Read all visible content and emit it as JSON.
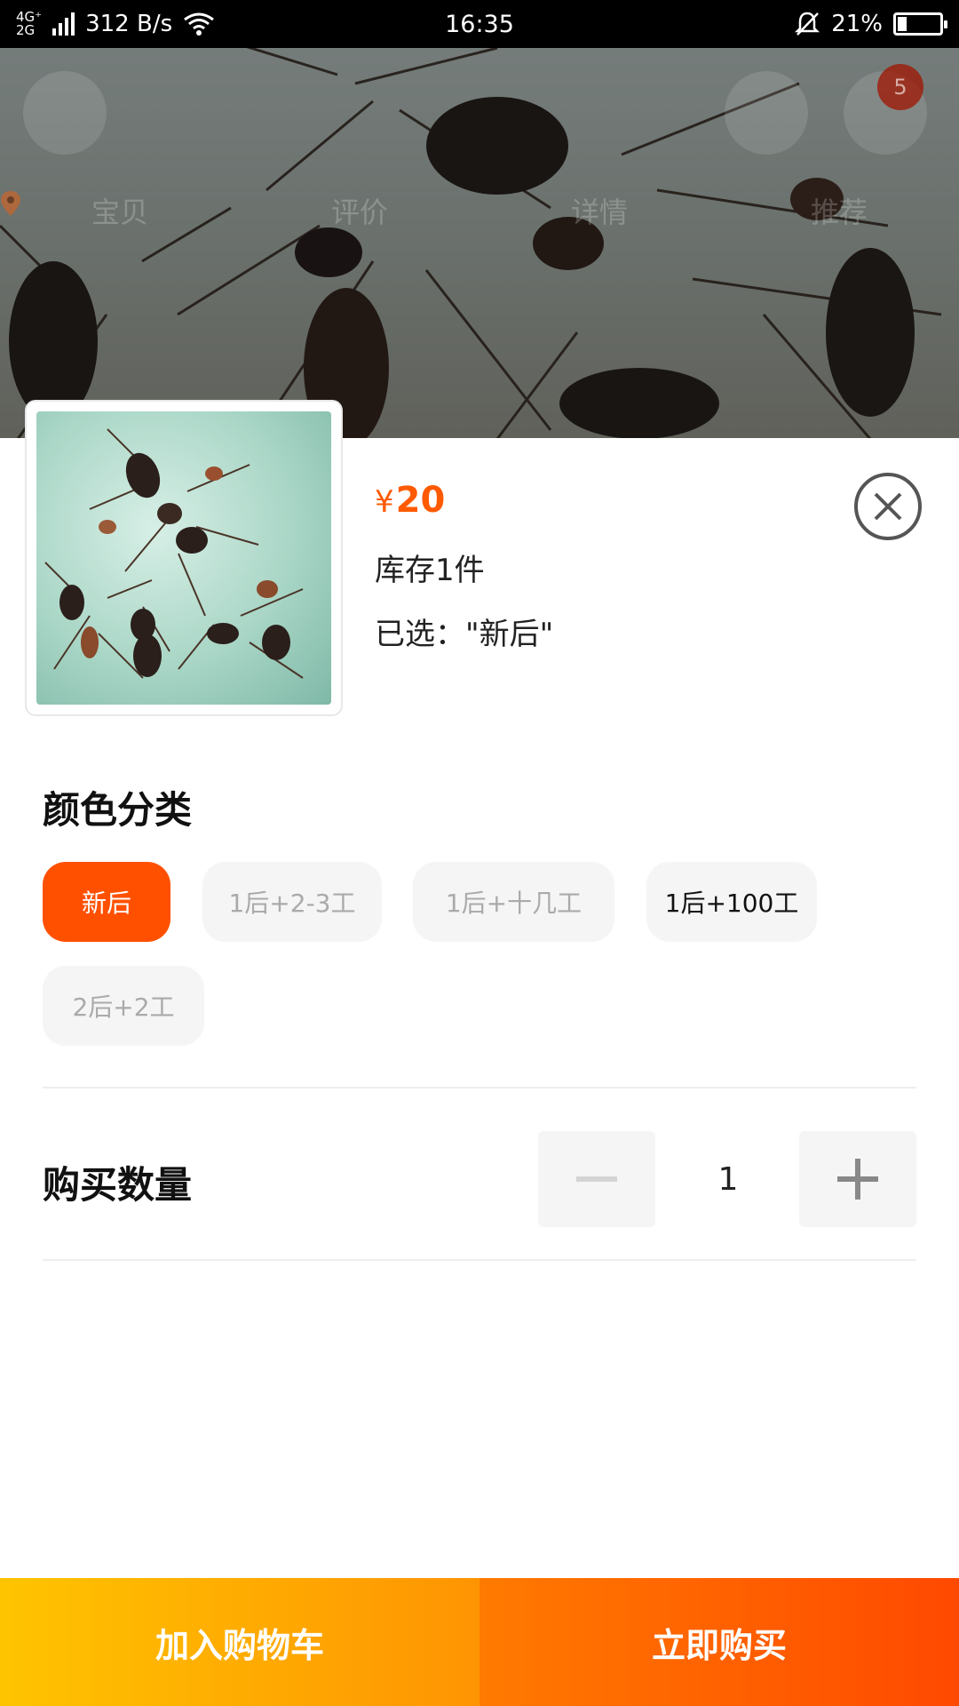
{
  "status_bar": {
    "network_top": "4G⁺",
    "network_bottom": "2G",
    "speed": "312 B/s",
    "time": "16:35",
    "battery_percent": "21%",
    "battery_level": 0.21
  },
  "background": {
    "cart_badge": "5",
    "tabs": [
      {
        "label": "宝贝"
      },
      {
        "label": "评价"
      },
      {
        "label": "详情"
      },
      {
        "label": "推荐"
      }
    ]
  },
  "product": {
    "price_symbol": "¥",
    "price": "20",
    "stock": "库存1件",
    "selected": "已选：\"新后\""
  },
  "spec": {
    "title": "颜色分类",
    "options": [
      {
        "label": "新后",
        "state": "active"
      },
      {
        "label": "1后+2-3工",
        "state": "disabled"
      },
      {
        "label": "1后+十几工",
        "state": "disabled"
      },
      {
        "label": "1后+100工",
        "state": "normal"
      },
      {
        "label": "2后+2工",
        "state": "disabled"
      }
    ]
  },
  "quantity": {
    "label": "购买数量",
    "value": "1"
  },
  "actions": {
    "add_to_cart": "加入购物车",
    "buy_now": "立即购买"
  },
  "colors": {
    "accent": "#ff5000",
    "cart_gradient": [
      "#ffc400",
      "#ff9402"
    ],
    "buy_gradient": [
      "#ff7a00",
      "#ff4900"
    ]
  }
}
